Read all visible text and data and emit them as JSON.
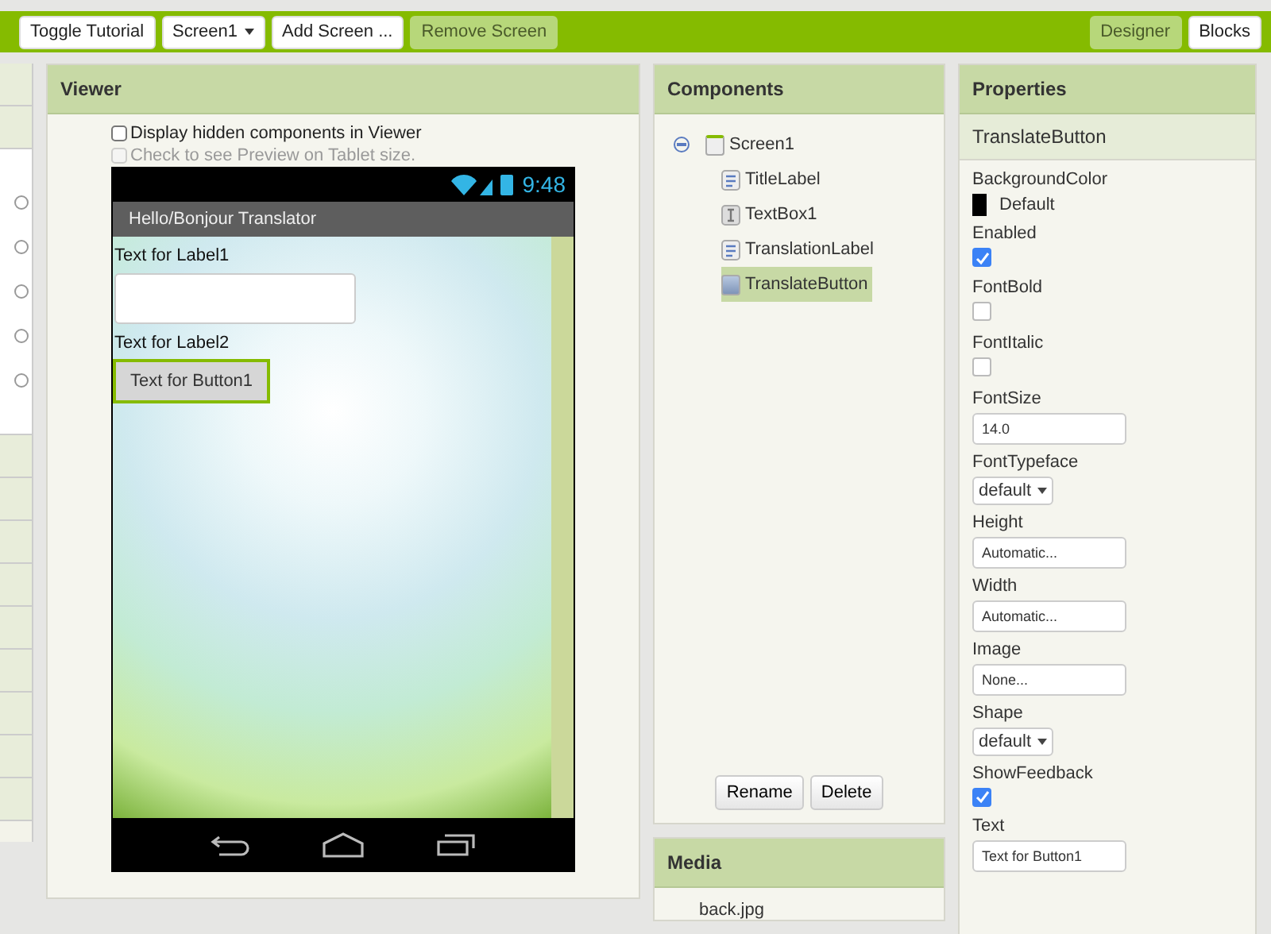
{
  "toolbar": {
    "left_buttons": [
      {
        "label": "Toggle Tutorial",
        "kind": "button",
        "disabled": false
      },
      {
        "label": "Screen1",
        "kind": "dropdown",
        "disabled": false
      },
      {
        "label": "Add Screen ...",
        "kind": "button",
        "disabled": false
      },
      {
        "label": "Remove Screen",
        "kind": "button",
        "disabled": true
      }
    ],
    "view_tabs": [
      {
        "label": "Designer",
        "selected": true
      },
      {
        "label": "Blocks",
        "selected": false
      }
    ]
  },
  "viewer": {
    "title": "Viewer",
    "options": [
      {
        "label": "Display hidden components in Viewer",
        "checked": false,
        "disabled": false
      },
      {
        "label": "Check to see Preview on Tablet size.",
        "checked": false,
        "disabled": true
      }
    ],
    "phone": {
      "time": "9:48",
      "app_title": "Hello/Bonjour Translator",
      "widgets": [
        {
          "kind": "label",
          "text": "Text for Label1",
          "selected": false
        },
        {
          "kind": "textbox",
          "selected": false
        },
        {
          "kind": "label",
          "text": "Text for Label2",
          "selected": false
        },
        {
          "kind": "button",
          "text": "Text for Button1",
          "selected": true
        }
      ]
    }
  },
  "components": {
    "title": "Components",
    "tree": [
      {
        "name": "Screen1",
        "kind": "screen",
        "expanded": true,
        "selected": false,
        "children": [
          {
            "name": "TitleLabel",
            "kind": "label",
            "selected": false
          },
          {
            "name": "TextBox1",
            "kind": "textbox",
            "selected": false
          },
          {
            "name": "TranslationLabel",
            "kind": "label",
            "selected": false
          },
          {
            "name": "TranslateButton",
            "kind": "button",
            "selected": true
          }
        ]
      }
    ],
    "buttons": [
      "Rename",
      "Delete"
    ]
  },
  "media": {
    "title": "Media",
    "files": [
      "back.jpg"
    ]
  },
  "properties": {
    "title": "Properties",
    "component": "TranslateButton",
    "items": [
      {
        "label": "BackgroundColor",
        "kind": "color",
        "value": "Default",
        "color": "#000000"
      },
      {
        "label": "Enabled",
        "kind": "checkbox",
        "checked": true
      },
      {
        "label": "FontBold",
        "kind": "checkbox",
        "checked": false
      },
      {
        "label": "FontItalic",
        "kind": "checkbox",
        "checked": false
      },
      {
        "label": "FontSize",
        "kind": "input",
        "value": "14.0"
      },
      {
        "label": "FontTypeface",
        "kind": "select",
        "value": "default"
      },
      {
        "label": "Height",
        "kind": "input",
        "value": "Automatic..."
      },
      {
        "label": "Width",
        "kind": "input",
        "value": "Automatic..."
      },
      {
        "label": "Image",
        "kind": "input",
        "value": "None..."
      },
      {
        "label": "Shape",
        "kind": "select",
        "value": "default"
      },
      {
        "label": "ShowFeedback",
        "kind": "checkbox",
        "checked": true
      },
      {
        "label": "Text",
        "kind": "input",
        "value": "Text for Button1"
      }
    ]
  }
}
